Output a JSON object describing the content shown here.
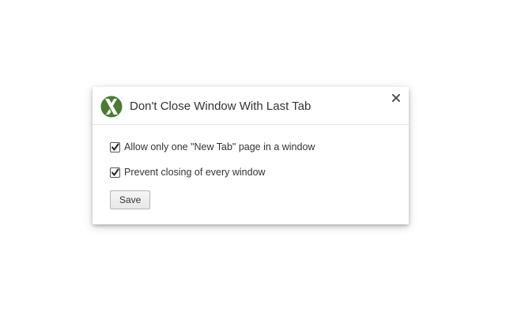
{
  "dialog": {
    "title": "Don't Close Window With Last Tab",
    "logo_icon": "green-x-logo-icon",
    "close_icon": "close-icon",
    "brand_color": "#4a7a34"
  },
  "options": [
    {
      "label": "Allow only one \"New Tab\" page in a window",
      "checked": true
    },
    {
      "label": "Prevent closing of every window",
      "checked": true
    }
  ],
  "save_label": "Save"
}
